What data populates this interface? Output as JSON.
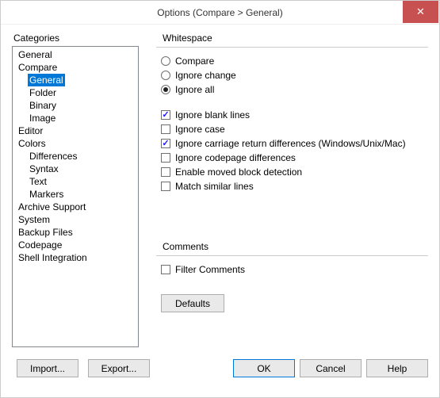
{
  "window": {
    "title": "Options (Compare > General)"
  },
  "categories": {
    "label": "Categories",
    "items": [
      {
        "label": "General",
        "depth": 0
      },
      {
        "label": "Compare",
        "depth": 0
      },
      {
        "label": "General",
        "depth": 1,
        "selected": true
      },
      {
        "label": "Folder",
        "depth": 1
      },
      {
        "label": "Binary",
        "depth": 1
      },
      {
        "label": "Image",
        "depth": 1
      },
      {
        "label": "Editor",
        "depth": 0
      },
      {
        "label": "Colors",
        "depth": 0
      },
      {
        "label": "Differences",
        "depth": 1
      },
      {
        "label": "Syntax",
        "depth": 1
      },
      {
        "label": "Text",
        "depth": 1
      },
      {
        "label": "Markers",
        "depth": 1
      },
      {
        "label": "Archive Support",
        "depth": 0
      },
      {
        "label": "System",
        "depth": 0
      },
      {
        "label": "Backup Files",
        "depth": 0
      },
      {
        "label": "Codepage",
        "depth": 0
      },
      {
        "label": "Shell Integration",
        "depth": 0
      }
    ]
  },
  "whitespace": {
    "label": "Whitespace",
    "options": [
      {
        "label": "Compare",
        "checked": false
      },
      {
        "label": "Ignore change",
        "checked": false
      },
      {
        "label": "Ignore all",
        "checked": true
      }
    ]
  },
  "checks": [
    {
      "label": "Ignore blank lines",
      "checked": true
    },
    {
      "label": "Ignore case",
      "checked": false
    },
    {
      "label": "Ignore carriage return differences (Windows/Unix/Mac)",
      "checked": true
    },
    {
      "label": "Ignore codepage differences",
      "checked": false
    },
    {
      "label": "Enable moved block detection",
      "checked": false
    },
    {
      "label": "Match similar lines",
      "checked": false
    }
  ],
  "comments": {
    "label": "Comments",
    "option": {
      "label": "Filter Comments",
      "checked": false
    }
  },
  "buttons": {
    "defaults": "Defaults",
    "import": "Import...",
    "export": "Export...",
    "ok": "OK",
    "cancel": "Cancel",
    "help": "Help"
  }
}
